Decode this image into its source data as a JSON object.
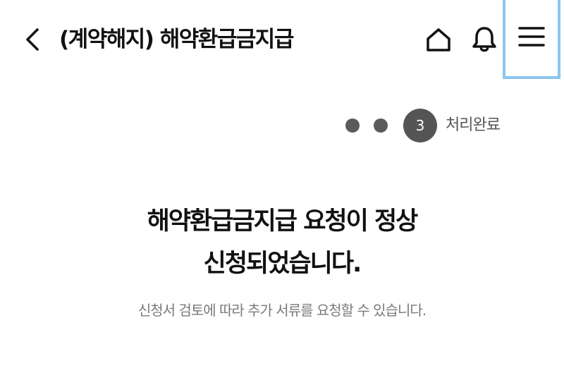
{
  "header": {
    "title": "(계약해지) 해약환급금지급",
    "back_icon": "chevron-left-icon",
    "home_icon": "home-icon",
    "notification_icon": "bell-icon",
    "menu_icon": "hamburger-menu-icon",
    "menu_highlight_color": "#8cc5ec"
  },
  "stepper": {
    "total_steps": 3,
    "current_step": "3",
    "current_label": "처리완료"
  },
  "result": {
    "headline_line1": "해약환급금지급 요청이 정상",
    "headline_line2": "신청되었습니다.",
    "subtext": "신청서 검토에 따라 추가 서류를 요청할 수 있습니다."
  }
}
